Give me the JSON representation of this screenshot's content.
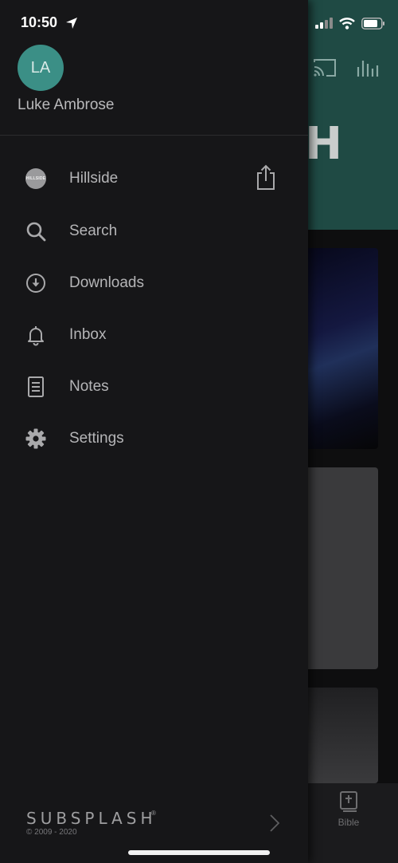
{
  "status_bar": {
    "time": "10:50"
  },
  "background": {
    "title_fragment": "CH",
    "tab_bible_label": "Bible"
  },
  "drawer": {
    "avatar_initials": "LA",
    "user_name": "Luke Ambrose",
    "hillside_logo_text": "HILLSIDE",
    "menu": [
      {
        "label": "Hillside",
        "icon": "hillside-logo-icon"
      },
      {
        "label": "Search",
        "icon": "search-icon"
      },
      {
        "label": "Downloads",
        "icon": "download-icon"
      },
      {
        "label": "Inbox",
        "icon": "bell-icon"
      },
      {
        "label": "Notes",
        "icon": "notes-icon"
      },
      {
        "label": "Settings",
        "icon": "gear-icon"
      }
    ],
    "footer": {
      "brand": "SUBSPLASH",
      "reg_mark": "®",
      "copyright": "© 2009 - 2020"
    }
  },
  "colors": {
    "accent": "#3b8f86",
    "header_bg": "#1f4a44",
    "drawer_bg": "#161618"
  }
}
